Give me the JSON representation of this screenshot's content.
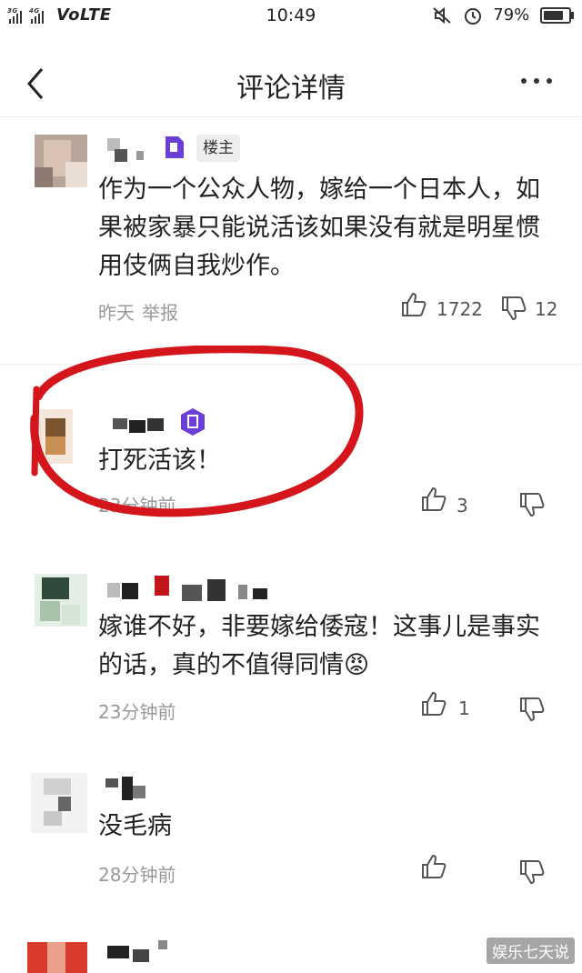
{
  "status_bar": {
    "network": "VoLTE",
    "signal_labels": [
      "3G",
      "4G"
    ],
    "time": "10:49",
    "battery": "79%",
    "battery_level": 0.79
  },
  "header": {
    "title": "评论详情"
  },
  "comments": [
    {
      "badge": "楼主",
      "text": "作为一个公众人物，嫁给一个日本人，如果被家暴只能说活该如果没有就是明星惯用伎俩自我炒作。",
      "time": "昨天",
      "report": "举报",
      "likes": "1722",
      "dislikes": "12"
    },
    {
      "text": "打死活该！",
      "time": "23分钟前",
      "likes": "3",
      "dislikes": ""
    },
    {
      "text": "嫁谁不好，非要嫁给倭寇！这事儿是事实的话，真的不值得同情😡",
      "time": "23分钟前",
      "likes": "1",
      "dislikes": ""
    },
    {
      "text": "没毛病",
      "time": "28分钟前",
      "likes": "",
      "dislikes": ""
    }
  ],
  "watermark": "娱乐七天说",
  "colors": {
    "annotation_circle": "#d4151b",
    "vip_badge": "#6b3fd6",
    "meta_gray": "#999999"
  }
}
